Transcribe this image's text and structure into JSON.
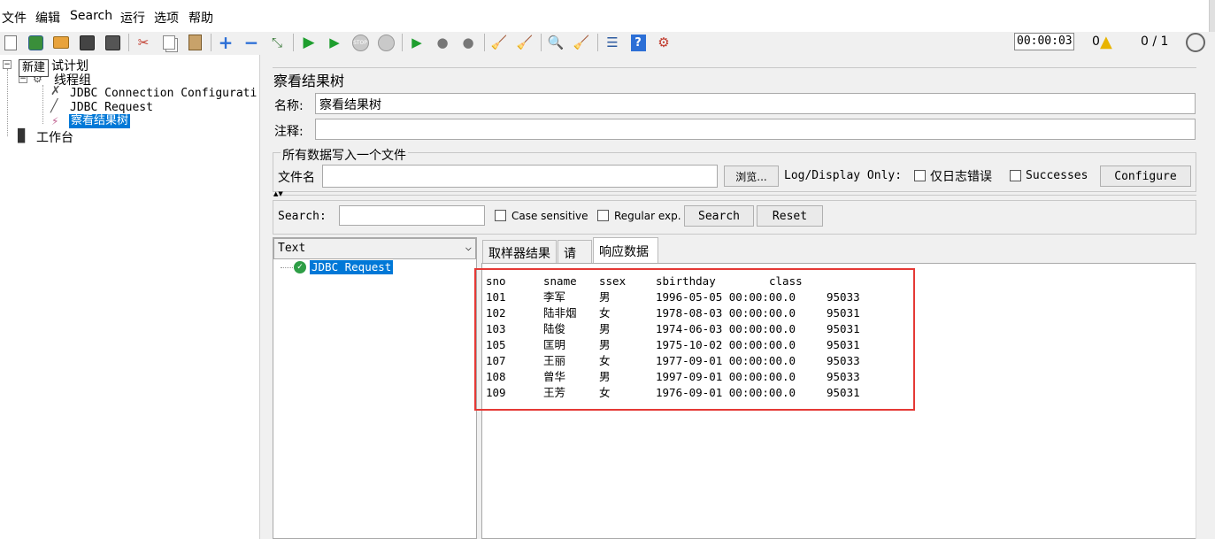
{
  "menu": [
    "文件",
    "编辑",
    "Search",
    "运行",
    "选项",
    "帮助"
  ],
  "toolbar": {
    "timer": "00:00:03",
    "warning_count": "0",
    "threads": "0 / 1"
  },
  "tree": {
    "tooltip": "新建",
    "plan_label": "试计划",
    "thread_group": "线程组",
    "items": [
      {
        "label": "JDBC Connection Configurati"
      },
      {
        "label": "JDBC Request"
      },
      {
        "label": "察看结果树"
      }
    ],
    "workbench": "工作台"
  },
  "panel": {
    "title": "察看结果树",
    "name_label": "名称:",
    "name_value": "察看结果树",
    "comment_label": "注释:",
    "file_group_title": "所有数据写入一个文件",
    "filename_label": "文件名",
    "browse_button": "浏览...",
    "log_display_label": "Log/Display Only:",
    "errors_only_label": "仅日志错误",
    "successes_label": "Successes",
    "configure_button": "Configure"
  },
  "search": {
    "label": "Search:",
    "case_sensitive": "Case sensitive",
    "regular_exp": "Regular exp.",
    "search_button": "Search",
    "reset_button": "Reset"
  },
  "results": {
    "renderer": "Text",
    "sample": "JDBC Request",
    "tabs": [
      "取样器结果",
      "请求",
      "响应数据"
    ],
    "active_tab": "响应数据",
    "columns": [
      "sno",
      "sname",
      "ssex",
      "sbirthday",
      "class"
    ],
    "rows": [
      [
        "101",
        "李军",
        "男",
        "1996-05-05 00:00:00.0",
        "95033"
      ],
      [
        "102",
        "陆非烟",
        "女",
        "1978-08-03 00:00:00.0",
        "95031"
      ],
      [
        "103",
        "陆俊",
        "男",
        "1974-06-03 00:00:00.0",
        "95031"
      ],
      [
        "105",
        "匡明",
        "男",
        "1975-10-02 00:00:00.0",
        "95031"
      ],
      [
        "107",
        "王丽",
        "女",
        "1977-09-01 00:00:00.0",
        "95033"
      ],
      [
        "108",
        "曾华",
        "男",
        "1997-09-01 00:00:00.0",
        "95033"
      ],
      [
        "109",
        "王芳",
        "女",
        "1976-09-01 00:00:00.0",
        "95031"
      ]
    ]
  },
  "colors": {
    "selection": "#0078d7",
    "highlight_box": "#e53935"
  }
}
